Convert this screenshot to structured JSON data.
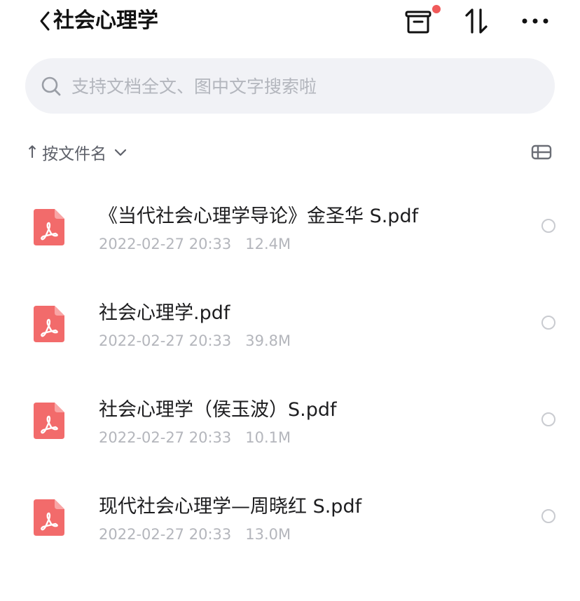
{
  "header": {
    "title": "社会心理学",
    "back_icon": "chevron-left-icon",
    "recycle_icon": "recycle-bin-icon",
    "recycle_badge_color": "#f05a5a",
    "sort_icon": "sort-arrows-icon",
    "more_icon": "more-dots-icon"
  },
  "search": {
    "placeholder": "支持文档全文、图中文字搜索啦",
    "value": "",
    "icon": "search-icon"
  },
  "sortbar": {
    "arrow": "↑",
    "label": "按文件名",
    "chevron_icon": "chevron-down-icon",
    "view_icon": "list-view-icon"
  },
  "files": [
    {
      "name": "《当代社会心理学导论》金圣华 S.pdf",
      "date": "2022-02-27 20:33",
      "size": "12.4M",
      "icon": "pdf-file-icon"
    },
    {
      "name": "社会心理学.pdf",
      "date": "2022-02-27 20:33",
      "size": "39.8M",
      "icon": "pdf-file-icon"
    },
    {
      "name": "社会心理学（侯玉波）S.pdf",
      "date": "2022-02-27 20:33",
      "size": "10.1M",
      "icon": "pdf-file-icon"
    },
    {
      "name": "现代社会心理学—周晓红 S.pdf",
      "date": "2022-02-27 20:33",
      "size": "13.0M",
      "icon": "pdf-file-icon"
    }
  ],
  "colors": {
    "pdf_icon": "#f26b6b",
    "accent_text": "#1d1d1f",
    "meta_text": "#b4b6bc",
    "search_bg": "#f1f2f6"
  }
}
